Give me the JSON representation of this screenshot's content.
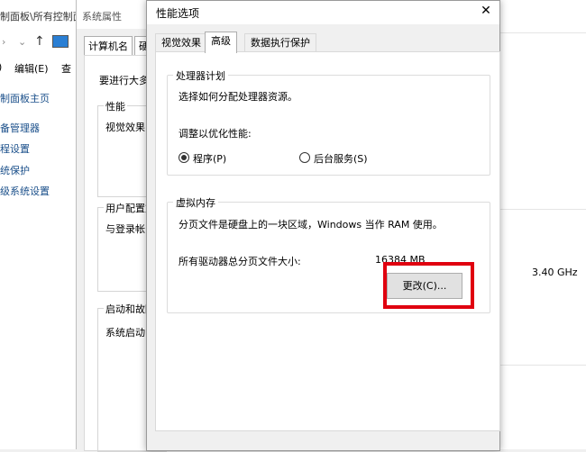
{
  "control_panel": {
    "breadcrumb": "制面板\\所有控制面",
    "menu": {
      "edit": "编辑(E)",
      "view": "查"
    },
    "links": [
      "制面板主页",
      "备管理器",
      "程设置",
      "统保护",
      "级系统设置"
    ]
  },
  "system_properties": {
    "title": "系统属性",
    "tabs": [
      "计算机名",
      "硬"
    ],
    "intro": "要进行大多",
    "groups": [
      {
        "label": "性能",
        "text": "视觉效果"
      },
      {
        "label": "用户配置文",
        "text": "与登录帐"
      },
      {
        "label": "启动和故障",
        "text": "系统启动"
      }
    ]
  },
  "background": {
    "cpu_speed": "3.40 GHz"
  },
  "dialog": {
    "title": "性能选项",
    "close": "✕",
    "tabs": [
      "视觉效果",
      "高级",
      "数据执行保护"
    ],
    "active_tab": "高级",
    "scheduling": {
      "label": "处理器计划",
      "desc": "选择如何分配处理器资源。",
      "adjust_label": "调整以优化性能:",
      "options": [
        {
          "label": "程序(P)",
          "selected": true
        },
        {
          "label": "后台服务(S)",
          "selected": false
        }
      ]
    },
    "virtual_memory": {
      "label": "虚拟内存",
      "desc": "分页文件是硬盘上的一块区域，Windows 当作 RAM 使用。",
      "total_label": "所有驱动器总分页文件大小:",
      "total_value": "16384 MB",
      "change_button": "更改(C)..."
    }
  },
  "highlight_color": "#e0000f"
}
